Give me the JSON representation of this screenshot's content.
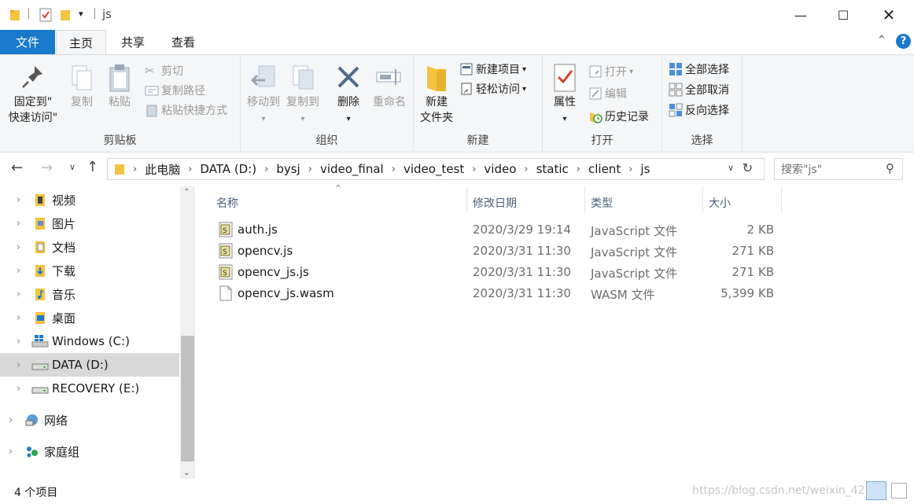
{
  "window": {
    "title": "js",
    "controls": [
      "minimize-icon",
      "maximize-icon",
      "close-icon"
    ]
  },
  "ribbon_tabs": [
    {
      "label": "文件"
    },
    {
      "label": "主页"
    },
    {
      "label": "共享"
    },
    {
      "label": "查看"
    }
  ],
  "ribbon": {
    "clipboard": {
      "group_label": "剪贴板",
      "pin_line1": "固定到\"",
      "pin_line2": "快速访问\"",
      "copy": "复制",
      "paste": "粘贴",
      "cut": "剪切",
      "copy_path": "复制路径",
      "paste_shortcut": "粘贴快捷方式"
    },
    "organize": {
      "group_label": "组织",
      "move_to": "移动到",
      "copy_to": "复制到",
      "delete": "删除",
      "rename": "重命名"
    },
    "new": {
      "group_label": "新建",
      "new_folder_line1": "新建",
      "new_folder_line2": "文件夹",
      "new_item": "新建项目",
      "easy_access": "轻松访问"
    },
    "open": {
      "group_label": "打开",
      "properties": "属性",
      "open": "打开",
      "edit": "编辑",
      "history": "历史记录"
    },
    "select": {
      "group_label": "选择",
      "select_all": "全部选择",
      "select_none": "全部取消",
      "invert": "反向选择"
    }
  },
  "address": {
    "breadcrumbs": [
      "此电脑",
      "DATA (D:)",
      "bysj",
      "video_final",
      "video_test",
      "video",
      "static",
      "client",
      "js"
    ],
    "search_placeholder": "搜索\"js\""
  },
  "nav": {
    "items": [
      {
        "label": "视频",
        "icon": "video-folder-icon"
      },
      {
        "label": "图片",
        "icon": "pictures-folder-icon"
      },
      {
        "label": "文档",
        "icon": "documents-folder-icon"
      },
      {
        "label": "下载",
        "icon": "downloads-folder-icon"
      },
      {
        "label": "音乐",
        "icon": "music-folder-icon"
      },
      {
        "label": "桌面",
        "icon": "desktop-folder-icon"
      },
      {
        "label": "Windows (C:)",
        "icon": "windows-drive-icon"
      },
      {
        "label": "DATA (D:)",
        "icon": "drive-icon",
        "selected": true
      },
      {
        "label": "RECOVERY (E:)",
        "icon": "drive-icon"
      },
      {
        "label": "网络",
        "icon": "network-icon"
      },
      {
        "label": "家庭组",
        "icon": "homegroup-icon"
      }
    ]
  },
  "files": {
    "columns": [
      "名称",
      "修改日期",
      "类型",
      "大小"
    ],
    "rows": [
      {
        "name": "auth.js",
        "date": "2020/3/29 19:14",
        "type": "JavaScript 文件",
        "size": "2 KB",
        "icon": "js-file-icon"
      },
      {
        "name": "opencv.js",
        "date": "2020/3/31 11:30",
        "type": "JavaScript 文件",
        "size": "271 KB",
        "icon": "js-file-icon"
      },
      {
        "name": "opencv_js.js",
        "date": "2020/3/31 11:30",
        "type": "JavaScript 文件",
        "size": "271 KB",
        "icon": "js-file-icon"
      },
      {
        "name": "opencv_js.wasm",
        "date": "2020/3/31 11:30",
        "type": "WASM 文件",
        "size": "5,399 KB",
        "icon": "blank-file-icon"
      }
    ]
  },
  "status": {
    "count": "4 个项目",
    "watermark": "https://blog.csdn.net/weixin_42"
  },
  "colors": {
    "file_tab": "#1979ca",
    "ribbon_bg": "#f5f6f7",
    "selected_nav": "#d9d9d9",
    "folder": "#f5c342"
  }
}
